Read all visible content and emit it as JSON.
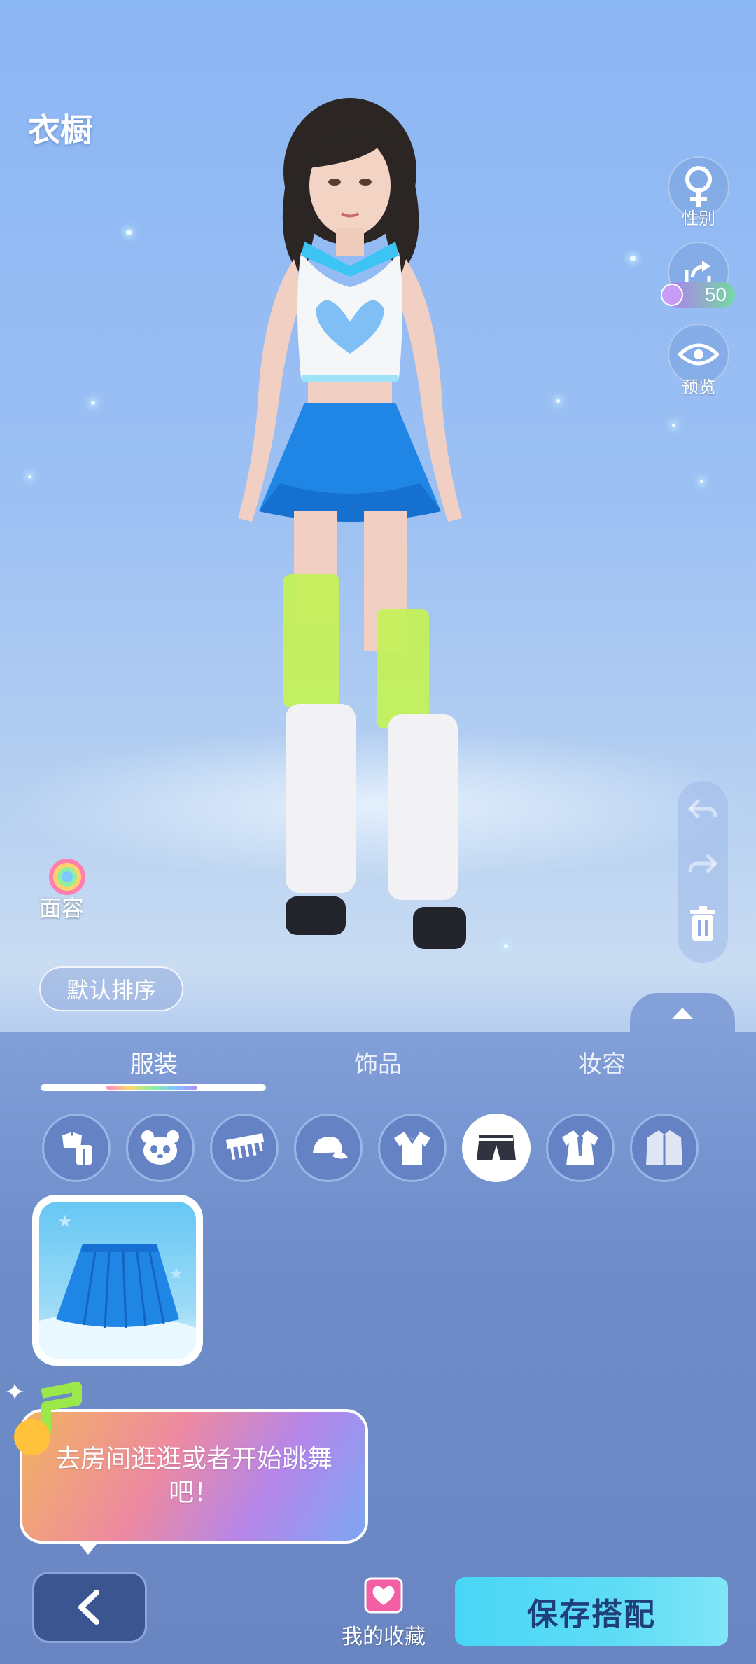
{
  "header": {
    "title": "衣橱"
  },
  "side_buttons": {
    "gender_label": "性别",
    "share_coin": "50",
    "preview_label": "预览"
  },
  "face": {
    "label": "面容"
  },
  "sort": {
    "label": "默认排序"
  },
  "tabs": [
    {
      "label": "服装",
      "active": true
    },
    {
      "label": "饰品",
      "active": false
    },
    {
      "label": "妆容",
      "active": false
    }
  ],
  "categories": [
    {
      "icon": "outfit-set-icon",
      "active": false
    },
    {
      "icon": "panda-icon",
      "active": false
    },
    {
      "icon": "comb-icon",
      "active": false
    },
    {
      "icon": "cap-icon",
      "active": false
    },
    {
      "icon": "shirt-icon",
      "active": false
    },
    {
      "icon": "shorts-icon",
      "active": true
    },
    {
      "icon": "suit-icon",
      "active": false
    },
    {
      "icon": "jacket-icon",
      "active": false
    }
  ],
  "items": [
    {
      "icon": "blue-pleated-skirt-icon",
      "selected": true
    }
  ],
  "tip": {
    "text": "去房间逛逛或者开始跳舞吧！"
  },
  "bottom": {
    "favorites_label": "我的收藏",
    "save_label": "保存搭配"
  },
  "colors": {
    "accent_cyan": "#48d6f6",
    "panel_blue": "#6d8cc8",
    "back_button": "#3a5590",
    "skirt_blue": "#1f86e6",
    "socks_lime": "#c4f05a"
  }
}
